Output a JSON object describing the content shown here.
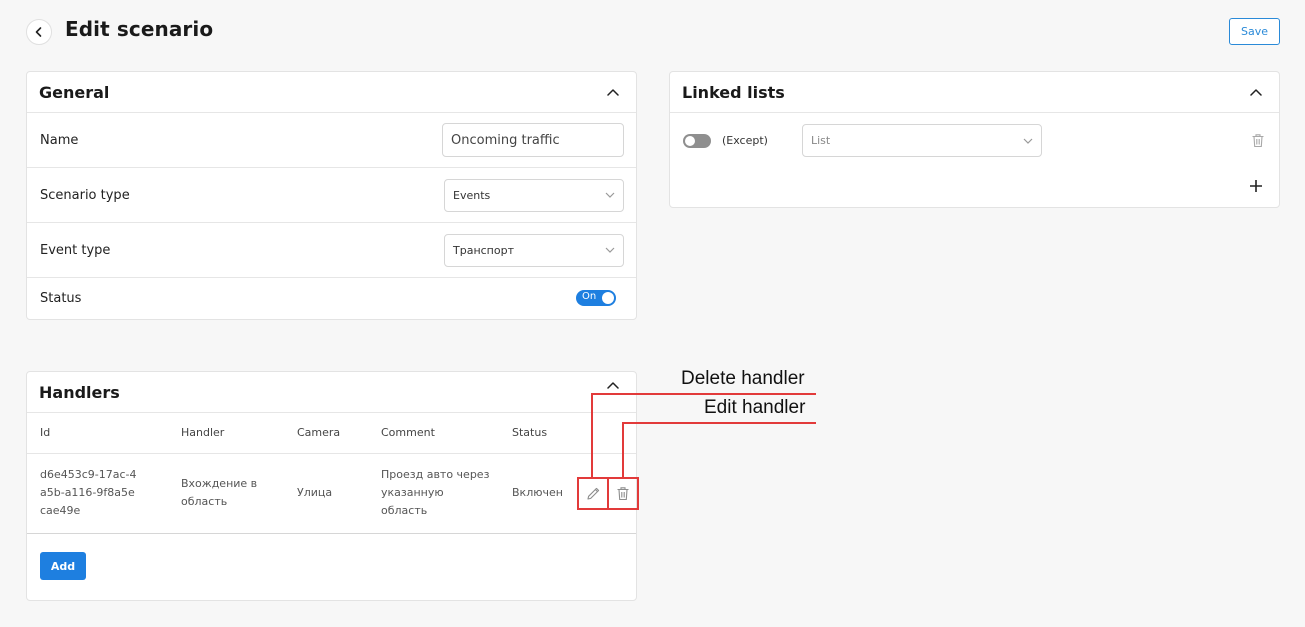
{
  "header": {
    "title": "Edit scenario",
    "save_label": "Save"
  },
  "general": {
    "title": "General",
    "name_label": "Name",
    "name_value": "Oncoming traffic",
    "scenario_type_label": "Scenario type",
    "scenario_type_value": "Events",
    "event_type_label": "Event type",
    "event_type_value": "Транспорт",
    "status_label": "Status",
    "status_value": "On"
  },
  "linked_lists": {
    "title": "Linked lists",
    "except_label": "(Except)",
    "list_placeholder": "List",
    "toggle_state": "off"
  },
  "handlers": {
    "title": "Handlers",
    "columns": [
      "Id",
      "Handler",
      "Camera",
      "Comment",
      "Status"
    ],
    "rows": [
      {
        "id": "d6e453c9-17ac-4a5b-a116-9f8a5ecae49e",
        "handler": "Вхождение в область",
        "camera": "Улица",
        "comment": "Проезд авто через указанную область",
        "status": "Включен"
      }
    ],
    "add_label": "Add"
  },
  "annotations": {
    "delete": "Delete handler",
    "edit": "Edit handler"
  },
  "colors": {
    "accent": "#1e7fe0",
    "annotation": "#e23a3a",
    "background": "#f7f7f7"
  },
  "icons": [
    "chevron-left-icon",
    "chevron-up-icon",
    "chevron-down-icon",
    "trash-icon",
    "pencil-icon",
    "plus-icon"
  ]
}
